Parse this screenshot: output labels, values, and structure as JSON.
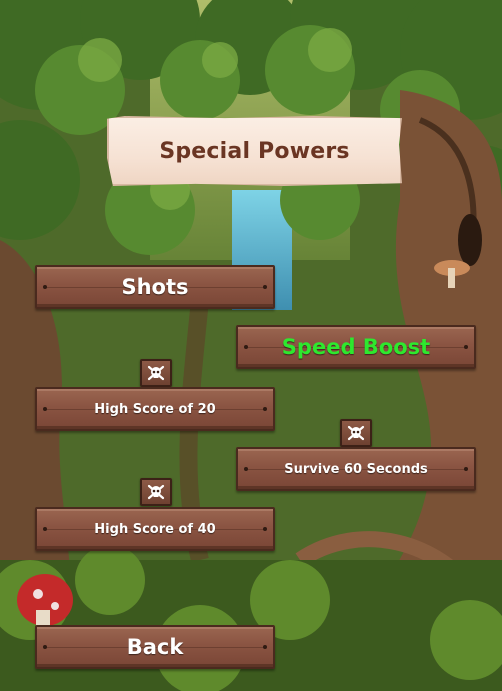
{
  "screen": {
    "title": "Special Powers"
  },
  "menu": {
    "shots": "Shots",
    "speed_boost": "Speed Boost",
    "high_score_20": "High Score of 20",
    "survive_60": "Survive 60 Seconds",
    "high_score_40": "High Score of 40",
    "back": "Back"
  },
  "icons": {
    "lock": "skull-crossbones-icon"
  },
  "colors": {
    "active_label": "#2ee82e",
    "plank": "#8a5442",
    "title_text": "#6a3523"
  }
}
